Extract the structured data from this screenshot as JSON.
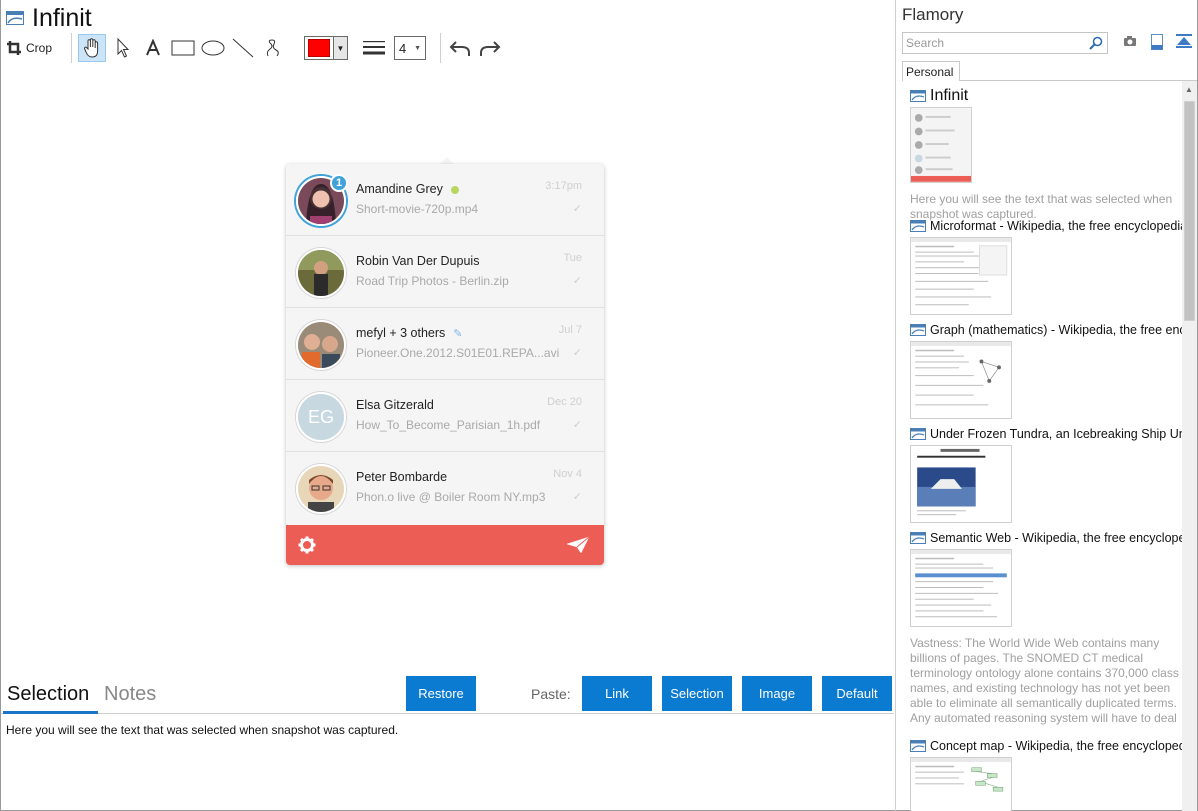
{
  "app": {
    "title": "Infinit"
  },
  "toolbar": {
    "crop_label": "Crop",
    "width_value": "4",
    "color": "#ff0000"
  },
  "conversations": [
    {
      "name": "Amandine Grey",
      "file": "Short-movie-720p.mp4",
      "time": "3:17pm",
      "badge": "1",
      "online": true
    },
    {
      "name": "Robin Van Der Dupuis",
      "file": "Road Trip Photos - Berlin.zip",
      "time": "Tue"
    },
    {
      "name": "mefyl + 3 others",
      "file": "Pioneer.One.2012.S01E01.REPA...avi",
      "time": "Jul 7",
      "editing": true
    },
    {
      "name": "Elsa Gitzerald",
      "file": "How_To_Become_Parisian_1h.pdf",
      "time": "Dec 20",
      "initials": "EG"
    },
    {
      "name": "Peter Bombarde",
      "file": "Phon.o live @ Boiler Room NY.mp3",
      "time": "Nov 4"
    }
  ],
  "bottom": {
    "tab_selection": "Selection",
    "tab_notes": "Notes",
    "restore": "Restore",
    "paste_label": "Paste:",
    "link": "Link",
    "selection": "Selection",
    "image": "Image",
    "default": "Default",
    "selection_text": "Here you will see the text that was selected when snapshot was captured."
  },
  "sidebar": {
    "title": "Flamory",
    "search_placeholder": "Search",
    "tab_personal": "Personal",
    "snapshots": [
      {
        "title": "Infinit",
        "desc": "Here you will see the text that was selected when snapshot was captured."
      },
      {
        "title": "Microformat - Wikipedia, the free encyclopedia"
      },
      {
        "title": "Graph (mathematics) - Wikipedia, the free encyclopedia"
      },
      {
        "title": "Under Frozen Tundra, an Icebreaking Ship Uncovers"
      },
      {
        "title": "Semantic Web - Wikipedia, the free encyclopedia",
        "desc": "Vastness: The World Wide Web contains many billions of pages. The SNOMED CT medical terminology ontology alone contains 370,000 class names, and existing technology has not yet been able to eliminate all semantically duplicated terms. Any automated reasoning system will have to deal with truly huge inputs."
      },
      {
        "title": "Concept map - Wikipedia, the free encyclopedia"
      }
    ]
  },
  "colors": {
    "accent": "#0b7ad1",
    "footer": "#ec5d55",
    "badge": "#3fa2d8",
    "online": "#b8d660"
  }
}
